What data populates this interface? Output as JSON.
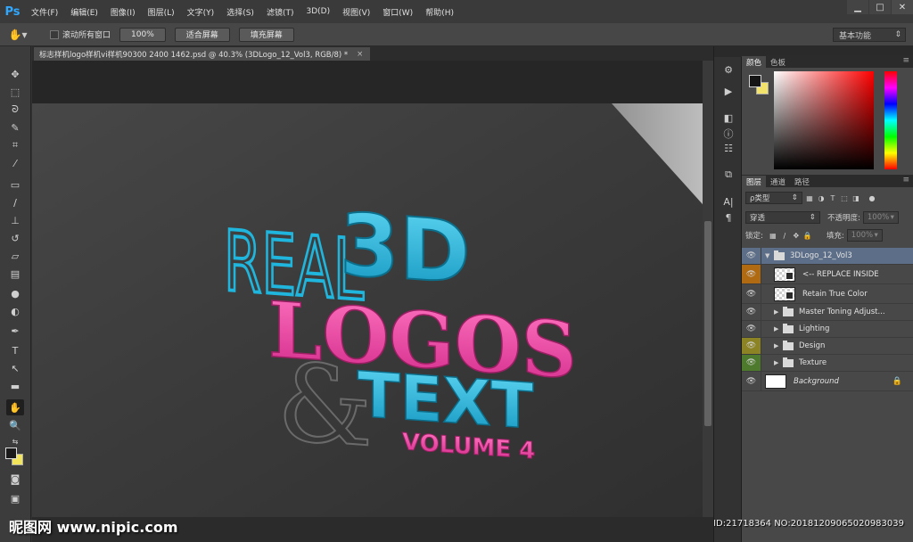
{
  "app": {
    "logo": "Ps"
  },
  "menu": [
    "文件(F)",
    "编辑(E)",
    "图像(I)",
    "图层(L)",
    "文字(Y)",
    "选择(S)",
    "滤镜(T)",
    "3D(D)",
    "视图(V)",
    "窗口(W)",
    "帮助(H)"
  ],
  "window_controls": {
    "minimize": "▁",
    "restore": "□",
    "close": "✕"
  },
  "options_bar": {
    "scroll_all_label": "滚动所有窗口",
    "zoom_100_label": "100%",
    "fit_screen_label": "适合屏幕",
    "fill_screen_label": "填充屏幕",
    "workspace": "基本功能"
  },
  "document": {
    "tab_title": "标志样机logo样机vi样机90300 2400 1462.psd @ 40.3% (3DLogo_12_Vol3, RGB/8) *",
    "close": "×"
  },
  "artwork": {
    "line1a": "REAL",
    "line1b": "3D",
    "line2": "LOGOS",
    "amp": "&",
    "line3": "TEXT",
    "line4": "VOLUME 4",
    "colors": {
      "cyan": "#1fb5dc",
      "pink": "#ec3fa0",
      "paper": "#3a3a3a"
    }
  },
  "color_panel": {
    "tabs": [
      "颜色",
      "色板"
    ],
    "foreground": "#151515",
    "background": "#f4e36a"
  },
  "layers_panel": {
    "tabs": [
      "图层",
      "通道",
      "路径"
    ],
    "filter_label": "ρ类型",
    "blend_mode": "穿透",
    "opacity_label": "不透明度:",
    "opacity_value": "100%",
    "lock_label": "锁定:",
    "fill_label": "填充:",
    "fill_value": "100%",
    "layers": [
      {
        "name": "3DLogo_12_Vol3",
        "type": "group-open",
        "selected": true,
        "label_color": ""
      },
      {
        "name": "<-- REPLACE INSIDE",
        "type": "smart",
        "label_color": "orange"
      },
      {
        "name": "Retain True Color",
        "type": "smart",
        "label_color": ""
      },
      {
        "name": "Master Toning Adjust...",
        "type": "group",
        "label_color": ""
      },
      {
        "name": "Lighting",
        "type": "group",
        "label_color": ""
      },
      {
        "name": "Design",
        "type": "group",
        "label_color": "yellow"
      },
      {
        "name": "Texture",
        "type": "group",
        "label_color": "green"
      },
      {
        "name": "Background",
        "type": "background",
        "label_color": ""
      }
    ]
  },
  "watermark": {
    "left": "昵图网 www.nipic.com",
    "right": "ID:21718364 NO:20181209065020983039"
  }
}
